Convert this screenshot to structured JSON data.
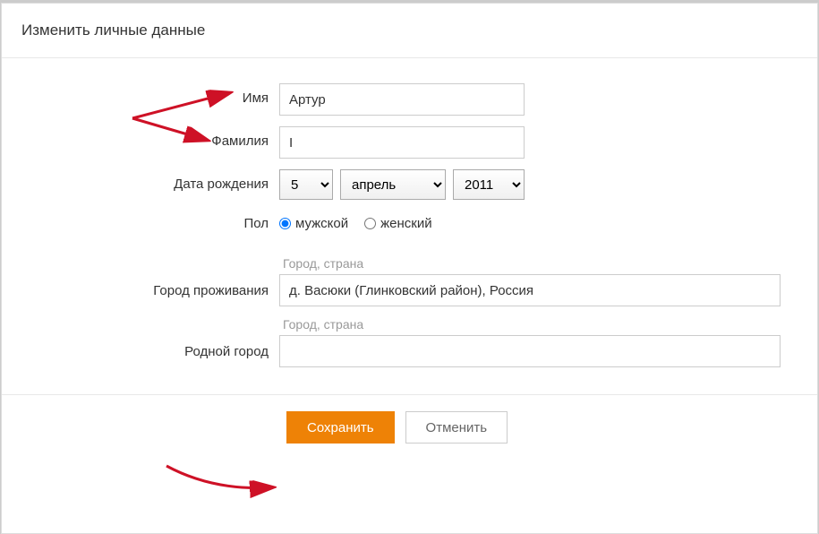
{
  "header": {
    "title": "Изменить личные данные"
  },
  "form": {
    "name_label": "Имя",
    "name_value": "Артур",
    "surname_label": "Фамилия",
    "surname_value": "I",
    "dob_label": "Дата рождения",
    "dob_day": "5",
    "dob_month": "апрель",
    "dob_year": "2011",
    "gender_label": "Пол",
    "gender_male": "мужской",
    "gender_female": "женский",
    "gender_selected": "male",
    "city_current_label": "Город проживания",
    "city_placeholder": "Город, страна",
    "city_current_value": "д. Васюки (Глинковский район), Россия",
    "city_home_label": "Родной город",
    "city_home_value": ""
  },
  "buttons": {
    "save": "Сохранить",
    "cancel": "Отменить"
  }
}
